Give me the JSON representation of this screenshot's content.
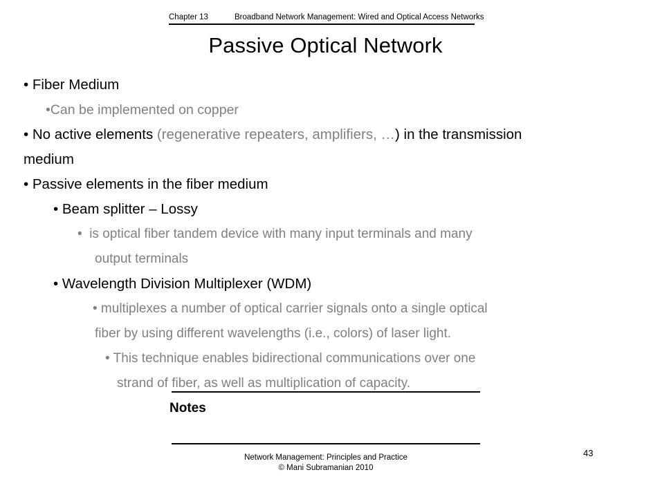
{
  "header": {
    "chapter": "Chapter 13",
    "subject": "Broadband Network Management:  Wired and Optical Access Networks"
  },
  "title": "Passive Optical Network",
  "body": [
    {
      "level": 0,
      "color": "black",
      "text": "• Fiber Medium"
    },
    {
      "level": 1,
      "color": "gray",
      "text": "•Can be implemented on copper"
    },
    {
      "level": 0,
      "color": "mixed",
      "prefix": "• No active elements ",
      "middle": "(regenerative repeaters, amplifiers, …",
      "suffix": ") in the transmission"
    },
    {
      "level": 0,
      "color": "black",
      "text": "medium"
    },
    {
      "level": 0,
      "color": "black",
      "text": "• Passive elements in the fiber medium"
    },
    {
      "level": 2,
      "color": "black",
      "text": "• Beam splitter – Lossy"
    },
    {
      "level": 3,
      "color": "gray",
      "text": "•  is optical fiber tandem device with many input terminals and many"
    },
    {
      "level": 4,
      "color": "gray",
      "text": "output terminals"
    },
    {
      "level": 2,
      "color": "black",
      "text": "• Wavelength Division Multiplexer (WDM)"
    },
    {
      "level": 5,
      "color": "gray",
      "text": "• multiplexes a number of optical carrier signals onto a single optical"
    },
    {
      "level": 4,
      "color": "gray",
      "text": "fiber by using different wavelengths (i.e., colors) of laser light."
    },
    {
      "level": 6,
      "color": "gray",
      "text": "• This technique enables bidirectional communications over one"
    },
    {
      "level": 6,
      "color": "gray",
      "text": "strand of fiber, as well as multiplication of capacity."
    }
  ],
  "notes": {
    "label": "Notes"
  },
  "footer": {
    "line1": "Network Management: Principles and Practice",
    "line2": "© Mani Subramanian 2010"
  },
  "page_number": "43",
  "colors": {
    "text_black": "#000000",
    "text_gray": "#808080",
    "background": "#ffffff",
    "rule": "#000000"
  }
}
